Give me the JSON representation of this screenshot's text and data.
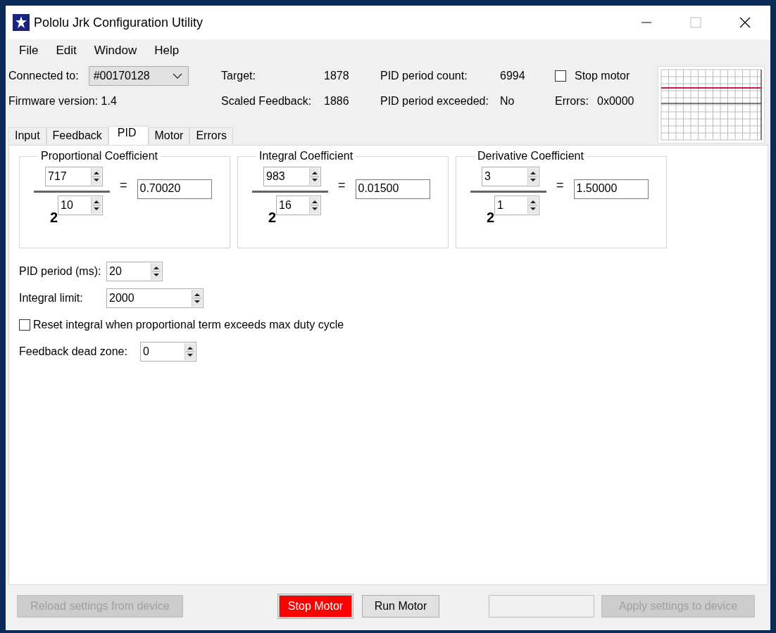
{
  "window": {
    "title": "Pololu Jrk Configuration Utility"
  },
  "menu": [
    "File",
    "Edit",
    "Window",
    "Help"
  ],
  "status": {
    "connected_label": "Connected to:",
    "device": "#00170128",
    "firmware": "Firmware version: 1.4",
    "readings": [
      {
        "label": "Target:",
        "value": "1878"
      },
      {
        "label": "Scaled Feedback:",
        "value": "1886"
      },
      {
        "label": "PID period count:",
        "value": "6994"
      },
      {
        "label": "PID period exceeded:",
        "value": "No"
      }
    ],
    "stop_motor": {
      "label": "Stop motor",
      "checked": false
    },
    "errors": {
      "label": "Errors:",
      "value": "0x0000"
    }
  },
  "tabs": [
    {
      "label": "Input",
      "selected": false
    },
    {
      "label": "Feedback",
      "selected": false
    },
    {
      "label": "PID",
      "selected": true
    },
    {
      "label": "Motor",
      "selected": false
    },
    {
      "label": "Errors",
      "selected": false
    }
  ],
  "coefficients": [
    {
      "title": "Proportional Coefficient",
      "numerator": "717",
      "base": "2",
      "exponent": "10",
      "equals": "=",
      "result": "0.70020"
    },
    {
      "title": "Integral Coefficient",
      "numerator": "983",
      "base": "2",
      "exponent": "16",
      "equals": "=",
      "result": "0.01500"
    },
    {
      "title": "Derivative Coefficient",
      "numerator": "3",
      "base": "2",
      "exponent": "1",
      "equals": "=",
      "result": "1.50000"
    }
  ],
  "settings": {
    "pid_period": {
      "label": "PID period (ms):",
      "value": "20"
    },
    "integral_limit": {
      "label": "Integral limit:",
      "value": "2000"
    },
    "reset_integral": {
      "label": "Reset integral when proportional term exceeds max duty cycle",
      "checked": false
    },
    "dead_zone": {
      "label": "Feedback dead zone:",
      "value": "0"
    }
  },
  "buttons": [
    {
      "label": "Reload settings from device",
      "kind": "normal",
      "disabled": true
    },
    {
      "label": "Stop Motor",
      "kind": "danger",
      "disabled": false
    },
    {
      "label": "Run Motor",
      "kind": "normal",
      "disabled": false
    },
    {
      "kind": "normal",
      "disabled": true
    },
    {
      "label": "Apply settings to device",
      "kind": "normal",
      "disabled": true
    }
  ]
}
